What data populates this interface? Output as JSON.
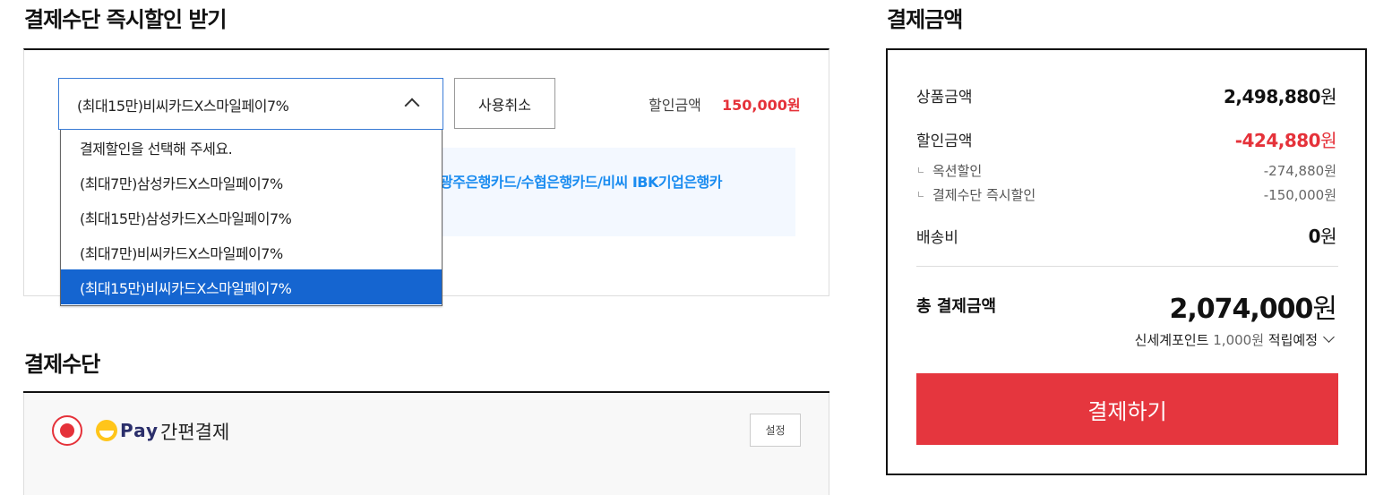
{
  "discount_section": {
    "title": "결제수단 즉시할인 받기",
    "selected_option": "(최대15만)비씨카드X스마일페이7%",
    "cancel_label": "사용취소",
    "discount_label": "할인금액",
    "discount_value": "150,000원",
    "info_text": "광주은행카드/수협은행카드/비씨 IBK기업은행카",
    "options": [
      "결제할인을 선택해 주세요.",
      "(최대7만)삼성카드X스마일페이7%",
      "(최대15만)삼성카드X스마일페이7%",
      "(최대7만)비씨카드X스마일페이7%",
      "(최대15만)비씨카드X스마일페이7%"
    ],
    "highlighted_index": 4
  },
  "method_section": {
    "title": "결제수단",
    "pay_brand": "Pay",
    "pay_label": "간편결제",
    "setting_label": "설정"
  },
  "summary": {
    "title": "결제금액",
    "product_label": "상품금액",
    "product_value": "2,498,880",
    "discount_label": "할인금액",
    "discount_value": "-424,880",
    "auction_label": "옥션할인",
    "auction_value": "-274,880원",
    "instant_label": "결제수단 즉시할인",
    "instant_value": "-150,000원",
    "shipping_label": "배송비",
    "shipping_value": "0",
    "won": "원",
    "total_label": "총 결제금액",
    "total_value": "2,074,000",
    "points_prefix": "신세계포인트",
    "points_amount": "1,000원",
    "points_suffix": "적립예정",
    "pay_button": "결제하기"
  },
  "colors": {
    "accent_red": "#e5363e",
    "select_blue": "#1565d0",
    "info_blue": "#1a8cf0"
  }
}
